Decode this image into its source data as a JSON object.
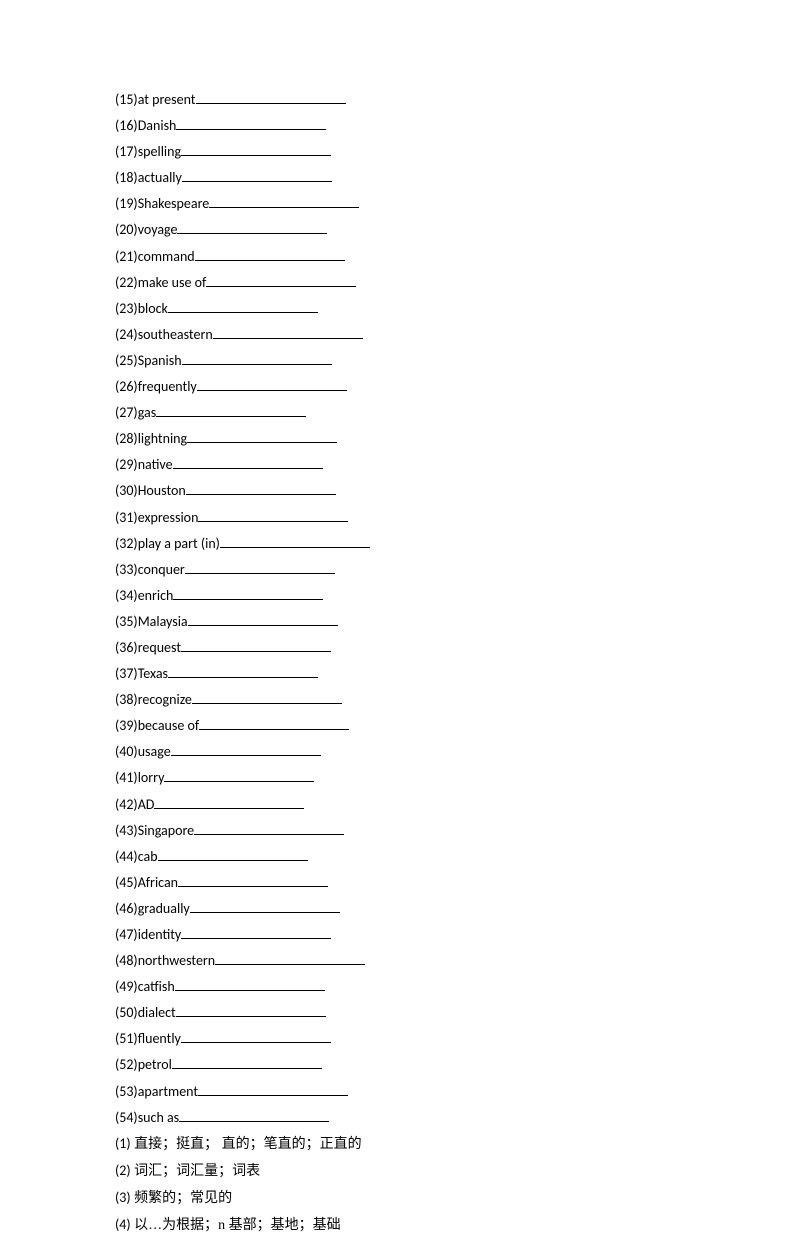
{
  "items": [
    {
      "n": "(15)",
      "w": "at present",
      "bw": 150
    },
    {
      "n": "(16)",
      "w": "Danish",
      "bw": 150
    },
    {
      "n": "(17)",
      "w": "spelling",
      "bw": 150
    },
    {
      "n": "(18)",
      "w": "actually",
      "bw": 150
    },
    {
      "n": "(19)",
      "w": "Shakespeare",
      "bw": 150
    },
    {
      "n": "(20)",
      "w": "voyage",
      "bw": 150
    },
    {
      "n": "(21)",
      "w": "command",
      "bw": 150
    },
    {
      "n": "(22)",
      "w": "make use of",
      "bw": 150
    },
    {
      "n": "(23)",
      "w": "block",
      "bw": 150
    },
    {
      "n": "(24)",
      "w": "southeastern",
      "bw": 150
    },
    {
      "n": "(25)",
      "w": "Spanish",
      "bw": 150
    },
    {
      "n": "(26)",
      "w": "frequently",
      "bw": 150
    },
    {
      "n": "(27)",
      "w": "gas",
      "bw": 150
    },
    {
      "n": "(28)",
      "w": "lightning",
      "bw": 150
    },
    {
      "n": "(29)",
      "w": "native",
      "bw": 150
    },
    {
      "n": "(30)",
      "w": "Houston",
      "bw": 150
    },
    {
      "n": "(31)",
      "w": "expression",
      "bw": 150
    },
    {
      "n": "(32)",
      "w": "play a part (in)",
      "bw": 150
    },
    {
      "n": "(33)",
      "w": "conquer",
      "bw": 150
    },
    {
      "n": "(34)",
      "w": "enrich",
      "bw": 150
    },
    {
      "n": "(35)",
      "w": "Malaysia",
      "bw": 150
    },
    {
      "n": "(36)",
      "w": "request",
      "bw": 150
    },
    {
      "n": "(37)",
      "w": "Texas",
      "bw": 150
    },
    {
      "n": "(38)",
      "w": "recognize",
      "bw": 150
    },
    {
      "n": "(39)",
      "w": "because of",
      "bw": 150
    },
    {
      "n": "(40)",
      "w": "usage",
      "bw": 150
    },
    {
      "n": "(41)",
      "w": "lorry",
      "bw": 150
    },
    {
      "n": "(42)",
      "w": "AD",
      "bw": 150
    },
    {
      "n": "(43)",
      "w": "Singapore",
      "bw": 150
    },
    {
      "n": "(44)",
      "w": "cab",
      "bw": 150
    },
    {
      "n": "(45)",
      "w": "African",
      "bw": 150
    },
    {
      "n": "(46)",
      "w": "gradually",
      "bw": 150
    },
    {
      "n": "(47)",
      "w": "identity",
      "bw": 150
    },
    {
      "n": "(48)",
      "w": "northwestern",
      "bw": 150
    },
    {
      "n": "(49)",
      "w": "catfish",
      "bw": 150
    },
    {
      "n": "(50)",
      "w": "dialect",
      "bw": 150
    },
    {
      "n": "(51)",
      "w": "fluently",
      "bw": 150
    },
    {
      "n": "(52)",
      "w": "petrol",
      "bw": 150
    },
    {
      "n": "(53)",
      "w": "apartment",
      "bw": 150
    },
    {
      "n": "(54)",
      "w": "such as",
      "bw": 150
    }
  ],
  "answers": [
    {
      "n": "(1)",
      "t": "  直接；挺直；   直的；笔直的；正直的"
    },
    {
      "n": "(2)",
      "t": "  词汇；词汇量；词表"
    },
    {
      "n": "(3)",
      "t": "   频繁的；常见的"
    },
    {
      "n": "(4)",
      "t": "  以…为根据；n 基部；基地；基础"
    }
  ]
}
